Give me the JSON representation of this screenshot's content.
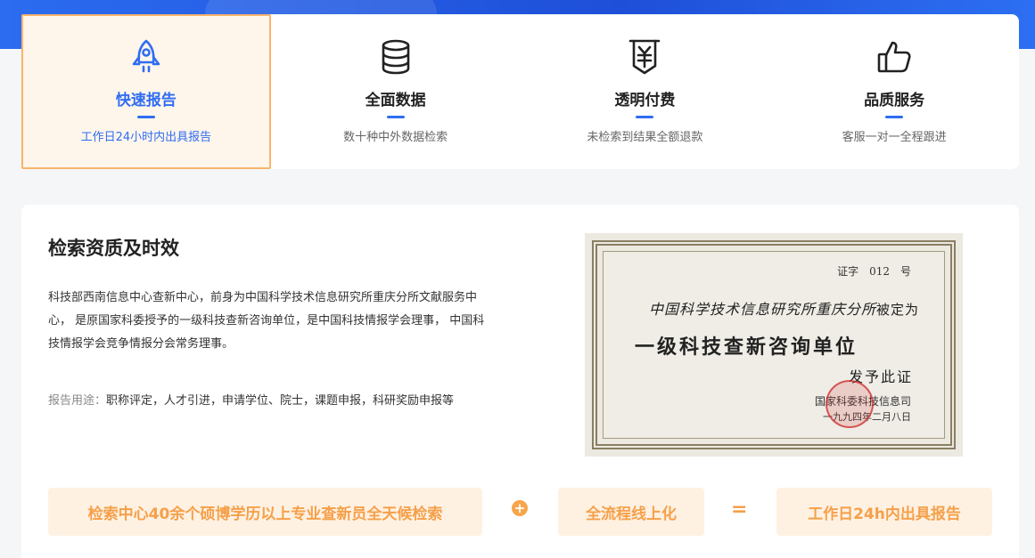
{
  "colors": {
    "accent": "#2f6df3",
    "orange": "#f5a04a",
    "active_bg": "#fff6eb",
    "active_border": "#f8b46b"
  },
  "features": [
    {
      "icon": "rocket-icon",
      "title": "快速报告",
      "desc": "工作日24小时内出具报告",
      "active": true
    },
    {
      "icon": "database-icon",
      "title": "全面数据",
      "desc": "数十种中外数据检索",
      "active": false
    },
    {
      "icon": "yuan-document-icon",
      "title": "透明付费",
      "desc": "未检索到结果全额退款",
      "active": false
    },
    {
      "icon": "thumbs-up-icon",
      "title": "品质服务",
      "desc": "客服一对一全程跟进",
      "active": false
    }
  ],
  "section": {
    "title": "检索资质及时效",
    "body": "科技部西南信息中心查新中心，前身为中国科学技术信息研究所重庆分所文献服务中心， 是原国家科委授予的一级科技查新咨询单位，是中国科技情报学会理事， 中国科技情报学会竞争情报分会常务理事。",
    "usage_label": "报告用途：",
    "usage_text": "职称评定，人才引进，申请学位、院士，课题申报，科研奖励申报等"
  },
  "certificate": {
    "number": "证字　012　号",
    "line1": "中国科学技术信息研究所重庆分所",
    "line1_suffix": "被定为",
    "line2": "一级科技查新咨询单位",
    "line3": "发予此证",
    "issuer": "国家科委科技信息司",
    "date": "一九九四年二月八日"
  },
  "formula": {
    "item1": "检索中心40余个硕博学历以上专业查新员全天候检索",
    "plus": "+",
    "item2": "全流程线上化",
    "equals": "=",
    "result": "工作日24h内出具报告"
  }
}
